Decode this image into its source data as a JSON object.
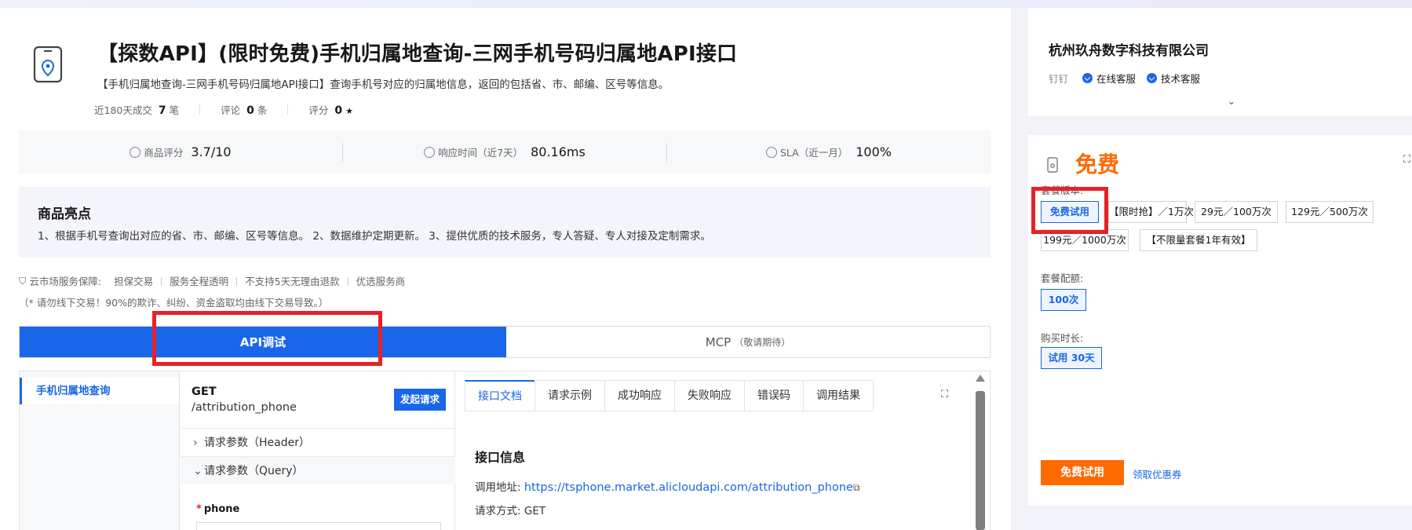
{
  "product": {
    "title": "【探数API】(限时免费)手机归属地查询-三网手机号码归属地API接口",
    "description": "【手机归属地查询-三网手机号码归属地API接口】查询手机号对应的归属地信息，返回的包括省、市、邮编、区号等信息。",
    "meta": {
      "deals_label": "近180天成交",
      "deals_value": "7",
      "deals_unit": "笔",
      "reviews_label": "评论",
      "reviews_value": "0",
      "reviews_unit": "条",
      "rating_label": "评分",
      "rating_value": "0",
      "rating_unit": "★"
    }
  },
  "stats": {
    "score_label": "商品评分",
    "score_value": "3.7/10",
    "response_label": "响应时间（近7天）",
    "response_value": "80.16ms",
    "sla_label": "SLA（近一月）",
    "sla_value": "100%"
  },
  "highlights": {
    "title": "商品亮点",
    "text": "1、根据手机号查询出对应的省、市、邮编、区号等信息。 2、数据维护定期更新。 3、提供优质的技术服务，专人答疑、专人对接及定制需求。"
  },
  "guarantee": {
    "label": "云市场服务保障:",
    "items": [
      "担保交易",
      "服务全程透明",
      "不支持5天无理由退款",
      "优选服务商"
    ],
    "warning": "（* 请勿线下交易！90%的欺诈、纠纷、资金盗取均由线下交易导致。）"
  },
  "main_tabs": {
    "api": "API调试",
    "mcp": "MCP",
    "mcp_note": "（敬请期待）"
  },
  "api_panel": {
    "nav_item": "手机归属地查询",
    "method": "GET",
    "path": "/attribution_phone",
    "send_button": "发起请求",
    "header_params": "请求参数（Header）",
    "query_params": "请求参数（Query）",
    "field_name": "phone",
    "tabs": [
      "接口文档",
      "请求示例",
      "成功响应",
      "失败响应",
      "错误码",
      "调用结果"
    ],
    "section_title": "接口信息",
    "url_label": "调用地址:",
    "url_value": "https://tsphone.market.alicloudapi.com/attribution_phone",
    "method_label": "请求方式:",
    "method_value": "GET"
  },
  "vendor": {
    "company": "杭州玖舟数字科技有限公司",
    "dingtalk": "钉钉",
    "online_service": "在线客服",
    "tech_service": "技术客服"
  },
  "purchase": {
    "price": "免费",
    "version_label": "套餐版本:",
    "versions": [
      "免费试用",
      "【限时抢】／1万次",
      "29元／100万次",
      "129元／500万次",
      "199元／1000万次",
      "【不限量套餐1年有效】"
    ],
    "quota_label": "套餐配额:",
    "quota_value": "100次",
    "duration_label": "购买时长:",
    "duration_value": "试用 30天",
    "buy_button": "免费试用",
    "coupon_link": "领取优惠券"
  },
  "colors": {
    "primary": "#1a66e8",
    "accent": "#ff6a00",
    "highlight_box": "#e52228"
  }
}
